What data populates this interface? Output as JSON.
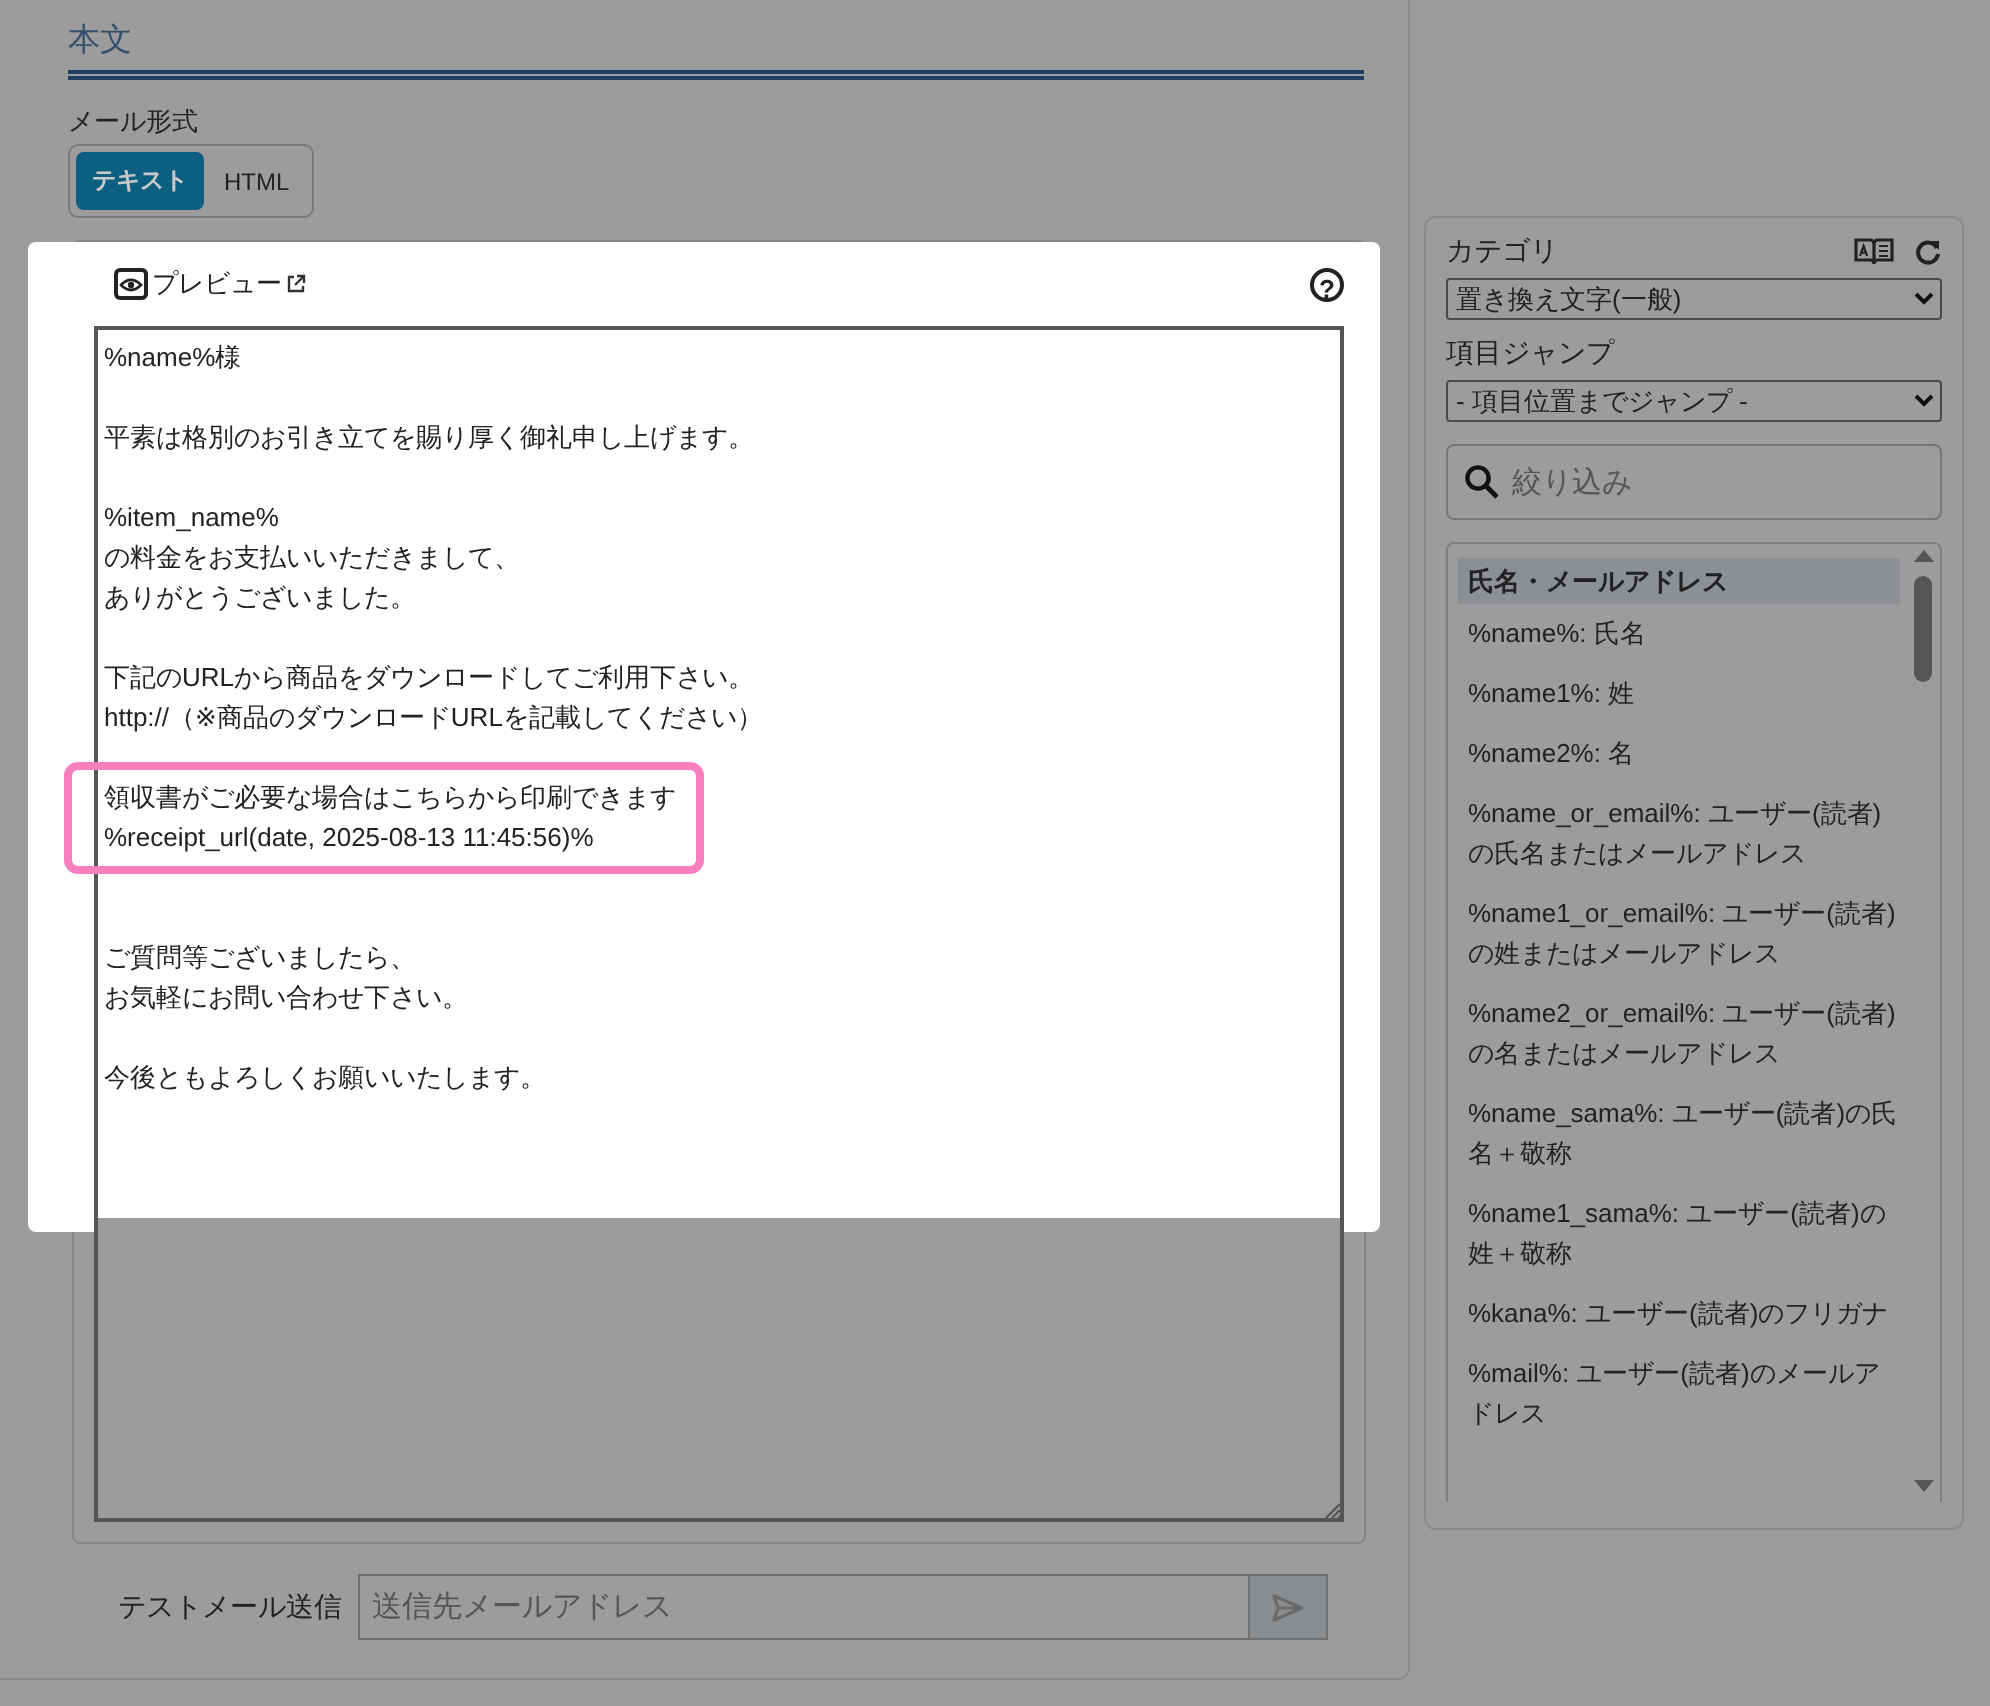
{
  "section_title": "本文",
  "mail_format": {
    "label": "メール形式",
    "options": [
      {
        "label": "テキスト",
        "selected": true
      },
      {
        "label": "HTML",
        "selected": false
      }
    ]
  },
  "editor": {
    "preview_label": "プレビュー",
    "help_button": "?",
    "paragraphs": [
      {
        "lines": [
          "%name%様"
        ],
        "highlighted": false
      },
      {
        "lines": [
          "平素は格別のお引き立てを賜り厚く御礼申し上げます。"
        ],
        "highlighted": false
      },
      {
        "lines": [
          "%item_name%",
          "の料金をお支払いいただきまして、",
          "ありがとうございました。"
        ],
        "highlighted": false
      },
      {
        "lines": [
          "下記のURLから商品をダウンロードしてご利用下さい。",
          "http://（※商品のダウンロードURLを記載してください）"
        ],
        "highlighted": false
      },
      {
        "lines": [
          "領収書がご必要な場合はこちらから印刷できます",
          "%receipt_url(date, 2025-08-13 11:45:56)%"
        ],
        "highlighted": true
      },
      {
        "lines": [
          "ご質問等ございましたら、",
          "お気軽にお問い合わせ下さい。"
        ],
        "highlighted": false
      },
      {
        "lines": [
          "今後ともよろしくお願いいたします。"
        ],
        "highlighted": false
      }
    ]
  },
  "test_mail": {
    "label": "テストメール送信",
    "placeholder": "送信先メールアドレス"
  },
  "sidebar": {
    "category_label": "カテゴリ",
    "category_value": "置き換え文字(一般)",
    "jump_label": "項目ジャンプ",
    "jump_value": "- 項目位置までジャンプ -",
    "filter_placeholder": "絞り込み",
    "items": [
      {
        "kind": "header",
        "text": "氏名・メールアドレス"
      },
      {
        "kind": "item",
        "text": "%name%: 氏名"
      },
      {
        "kind": "item",
        "text": "%name1%: 姓"
      },
      {
        "kind": "item",
        "text": "%name2%: 名"
      },
      {
        "kind": "item",
        "text": "%name_or_email%: ユーザー(読者)の氏名またはメールアドレス"
      },
      {
        "kind": "item",
        "text": "%name1_or_email%: ユーザー(読者)の姓またはメールアドレス"
      },
      {
        "kind": "item",
        "text": "%name2_or_email%: ユーザー(読者)の名またはメールアドレス"
      },
      {
        "kind": "item",
        "text": "%name_sama%: ユーザー(読者)の氏名＋敬称"
      },
      {
        "kind": "item",
        "text": "%name1_sama%: ユーザー(読者)の姓＋敬称"
      },
      {
        "kind": "item",
        "text": "%kana%: ユーザー(読者)のフリガナ"
      },
      {
        "kind": "item",
        "text": "%mail%: ユーザー(読者)のメールアドレス"
      }
    ]
  }
}
